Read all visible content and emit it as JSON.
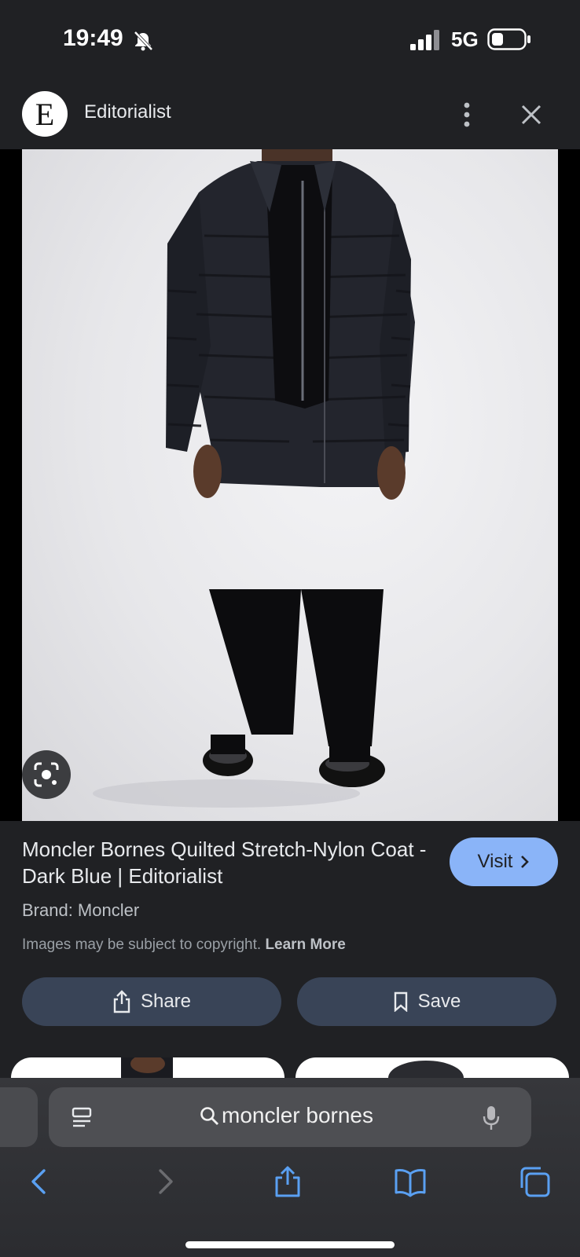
{
  "status_bar": {
    "time": "19:49",
    "network": "5G",
    "icons": [
      "bell-slash-icon",
      "signal-icon",
      "battery-icon"
    ]
  },
  "header": {
    "logo_letter": "E",
    "site_name": "Editorialist",
    "icons": [
      "more-vert-icon",
      "close-icon"
    ]
  },
  "product": {
    "title": "Moncler Bornes Quilted Stretch-Nylon Coat - Dark Blue | Editorialist",
    "visit_label": "Visit",
    "brand": "Brand: Moncler",
    "copyright_text": "Images may be subject to copyright.",
    "learn_more": "Learn More"
  },
  "actions": {
    "share_label": "Share",
    "save_label": "Save"
  },
  "browser": {
    "address_text": "moncler bornes",
    "toolbar_icons": [
      "back-icon",
      "forward-icon",
      "share-icon",
      "bookmarks-icon",
      "tabs-icon"
    ]
  },
  "colors": {
    "background": "#202124",
    "accent": "#8ab4f8",
    "action_button": "#394457",
    "toolbar_icon": "#5aa0f2"
  }
}
